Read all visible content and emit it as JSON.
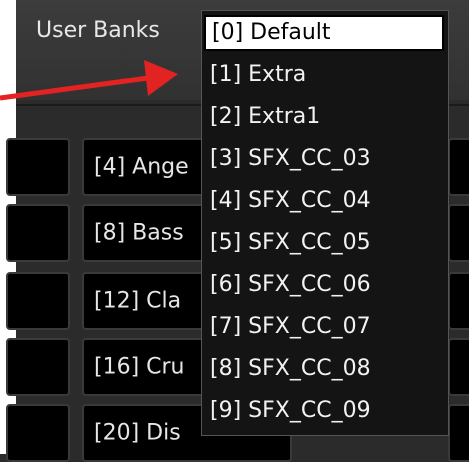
{
  "topbar": {
    "label": "User Banks"
  },
  "dropdown": {
    "items": [
      "[0] Default",
      "[1] Extra",
      "[2] Extra1",
      "[3] SFX_CC_03",
      "[4] SFX_CC_04",
      "[5] SFX_CC_05",
      "[6] SFX_CC_06",
      "[7] SFX_CC_07",
      "[8] SFX_CC_08",
      "[9] SFX_CC_09"
    ],
    "selected_index": 0
  },
  "slots": {
    "row1": "[4] Ange",
    "row2": "[8] Bass",
    "row3": "[12] Cla",
    "row4": "[16] Cru",
    "row5": "[20] Dis"
  },
  "annotation": {
    "arrow_color": "#e32222"
  }
}
